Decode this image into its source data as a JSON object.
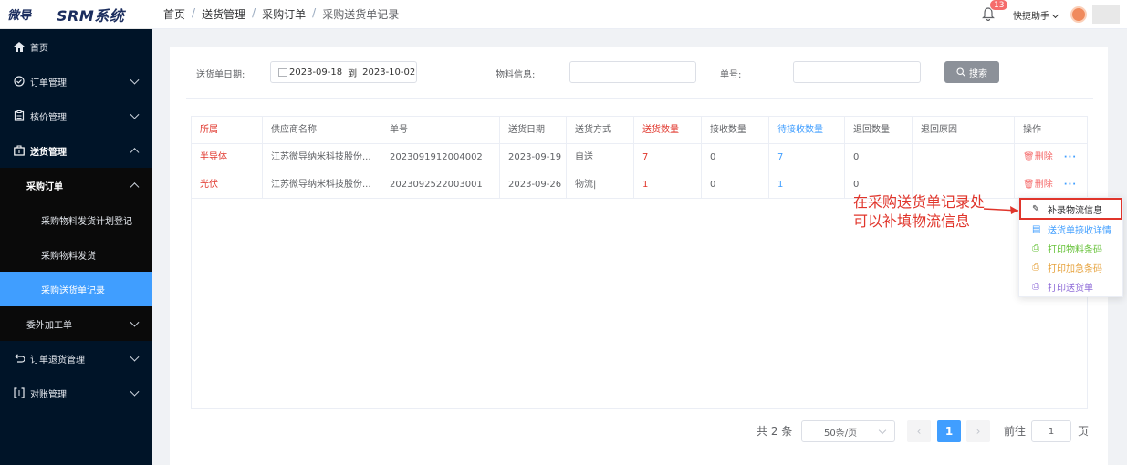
{
  "app": {
    "logo_mark": "微导",
    "title": "SRM系统"
  },
  "header": {
    "breadcrumb": [
      "首页",
      "送货管理",
      "采购订单",
      "采购送货单记录"
    ],
    "separator": "/",
    "notifications": "13",
    "helper": "快捷助手"
  },
  "sidebar": {
    "home": "首页",
    "order_mgmt": "订单管理",
    "price_mgmt": "核价管理",
    "delivery_mgmt": "送货管理",
    "purchase_order": "采购订单",
    "sub_plan": "采购物料发货计划登记",
    "sub_ship": "采购物料发货",
    "sub_record": "采购送货单记录",
    "outsource": "委外加工单",
    "return_mgmt": "订单退货管理",
    "reconcile_mgmt": "对账管理"
  },
  "filters": {
    "date_label": "送货单日期:",
    "date_start": "2023-09-18",
    "date_to": "到",
    "date_end": "2023-10-02",
    "material_label": "物料信息:",
    "order_label": "单号:",
    "search": "搜索"
  },
  "table": {
    "headers": [
      "所属",
      "供应商名称",
      "单号",
      "送货日期",
      "送货方式",
      "送货数量",
      "接收数量",
      "待接收数量",
      "退回数量",
      "退回原因",
      "操作"
    ],
    "rows": [
      {
        "belong": "半导体",
        "supplier": "江苏微导纳米科技股份...",
        "no": "2023091912004002",
        "date": "2023-09-19",
        "method": "自送",
        "qty": "7",
        "received": "0",
        "pending": "7",
        "returned": "0",
        "reason": ""
      },
      {
        "belong": "光伏",
        "supplier": "江苏微导纳米科技股份...",
        "no": "2023092522003001",
        "date": "2023-09-26",
        "method": "物流|",
        "qty": "1",
        "received": "0",
        "pending": "1",
        "returned": "0",
        "reason": ""
      }
    ],
    "delete_label": "删除",
    "more_label": "···"
  },
  "dropdown": {
    "items": [
      "补录物流信息",
      "送货单接收详情",
      "打印物料条码",
      "打印加急条码",
      "打印送货单"
    ],
    "colors": [
      "#303133",
      "#409eff",
      "#67c23a",
      "#e6a23c",
      "#8e6bd8"
    ]
  },
  "annotation": {
    "line1": "在采购送货单记录处",
    "line2": "可以补填物流信息"
  },
  "pagination": {
    "total": "共 2 条",
    "page_size": "50条/页",
    "prev": "‹",
    "current": "1",
    "next": "›",
    "goto": "前往",
    "goto_value": "1",
    "page_unit": "页"
  }
}
